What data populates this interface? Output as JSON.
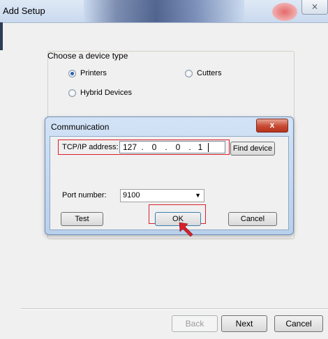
{
  "window": {
    "title": "Add Setup",
    "close_glyph": "⨯"
  },
  "device_group": {
    "legend": "Choose a device type",
    "options": [
      {
        "label": "Printers",
        "selected": true
      },
      {
        "label": "Cutters",
        "selected": false
      },
      {
        "label": "Hybrid Devices",
        "selected": false
      }
    ]
  },
  "dialog": {
    "title": "Communication",
    "close_glyph": "x",
    "ip_label": "TCP/IP address:",
    "ip_octets": [
      "127",
      "0",
      "0",
      "1"
    ],
    "ip_separator": ".",
    "find_button": "Find device",
    "port_label": "Port number:",
    "port_value": "9100",
    "test_button": "Test",
    "ok_button": "OK",
    "cancel_button": "Cancel"
  },
  "nav": {
    "back": "Back",
    "next": "Next",
    "cancel": "Cancel"
  },
  "colors": {
    "highlight": "#d9202a",
    "arrow": "#d9202a"
  },
  "icons": {
    "cursor": "red-arrow-pointer-icon"
  }
}
